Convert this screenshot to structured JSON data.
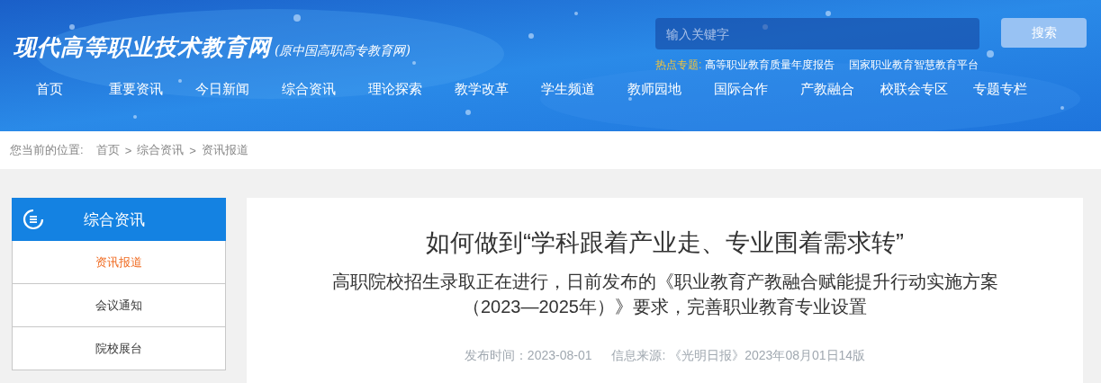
{
  "header": {
    "logo": {
      "title": "现代高等职业技术教育网",
      "subtitle": "(原中国高职高专教育网)"
    },
    "search": {
      "placeholder": "输入关键字",
      "button": "搜索"
    },
    "hot_topics": {
      "label": "热点专题:",
      "links": [
        "高等职业教育质量年度报告",
        "国家职业教育智慧教育平台"
      ]
    },
    "nav": [
      "首页",
      "重要资讯",
      "今日新闻",
      "综合资讯",
      "理论探索",
      "教学改革",
      "学生频道",
      "教师园地",
      "国际合作",
      "产教融合",
      "校联会专区",
      "专题专栏"
    ]
  },
  "breadcrumb": {
    "label": "您当前的位置:",
    "items": [
      "首页",
      "综合资讯",
      "资讯报道"
    ],
    "separator": ">"
  },
  "sidebar": {
    "title": "综合资讯",
    "items": [
      {
        "label": "资讯报道",
        "selected": true
      },
      {
        "label": "会议通知",
        "selected": false
      },
      {
        "label": "院校展台",
        "selected": false
      }
    ]
  },
  "article": {
    "title": "如何做到“学科跟着产业走、专业围着需求转”",
    "subtitle": "高职院校招生录取正在进行，日前发布的《职业教育产教融合赋能提升行动实施方案（2023—2025年）》要求，完善职业教育专业设置",
    "published": "发布时间：2023-08-01",
    "source": "信息来源: 《光明日报》2023年08月01日14版"
  }
}
